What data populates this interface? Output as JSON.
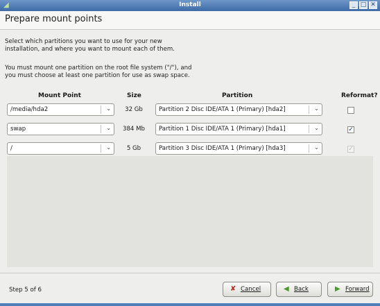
{
  "window": {
    "title": "Install"
  },
  "header": {
    "title": "Prepare mount points"
  },
  "instructions": {
    "line1": "Select which partitions you want to use for your new",
    "line2": "installation, and where you want to mount each of them.",
    "line3": "You must mount one partition on the root file system (\"/\"), and",
    "line4": "you must choose at least one partition for use as swap space."
  },
  "columns": {
    "mount": "Mount Point",
    "size": "Size",
    "partition": "Partition",
    "reformat": "Reformat?"
  },
  "rows": [
    {
      "mount": "/media/hda2",
      "size": "32 Gb",
      "partition": "Partition 2 Disc IDE/ATA 1 (Primary) [hda2]",
      "reformat": false,
      "reformat_disabled": false
    },
    {
      "mount": "swap",
      "size": "384 Mb",
      "partition": "Partition 1 Disc IDE/ATA 1 (Primary) [hda1]",
      "reformat": true,
      "reformat_disabled": false
    },
    {
      "mount": "/",
      "size": "5 Gb",
      "partition": "Partition 3 Disc IDE/ATA 1 (Primary) [hda3]",
      "reformat": true,
      "reformat_disabled": true
    }
  ],
  "footer": {
    "step": "Step 5 of 6",
    "cancel": "Cancel",
    "back": "Back",
    "forward": "Forward"
  },
  "icons": {
    "cancel": "x-icon",
    "back": "arrow-left-icon",
    "forward": "arrow-right-icon"
  }
}
